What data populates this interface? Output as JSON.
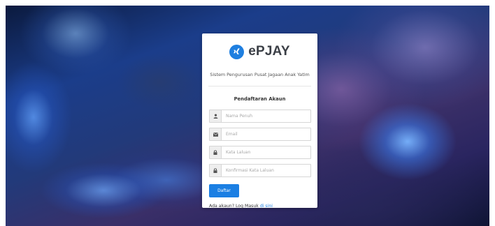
{
  "app": {
    "brand_name": "ePJAY",
    "subtitle": "Sistem Pengurusan Pusat Jagaan Anak Yatim",
    "brand_color": "#1f7fe0"
  },
  "form": {
    "heading": "Pendaftaran Akaun",
    "fields": [
      {
        "icon": "user-icon",
        "placeholder": "Nama Penuh",
        "value": ""
      },
      {
        "icon": "envelope-icon",
        "placeholder": "Email",
        "value": ""
      },
      {
        "icon": "lock-icon",
        "placeholder": "Kata Laluan",
        "value": ""
      },
      {
        "icon": "lock-icon",
        "placeholder": "Konfirmasi Kata Laluan",
        "value": ""
      }
    ],
    "submit_label": "Daftar",
    "login_prompt": "Ada akaun? Log Masuk",
    "login_link": "di sini",
    "button_color": "#1b7fe3"
  }
}
